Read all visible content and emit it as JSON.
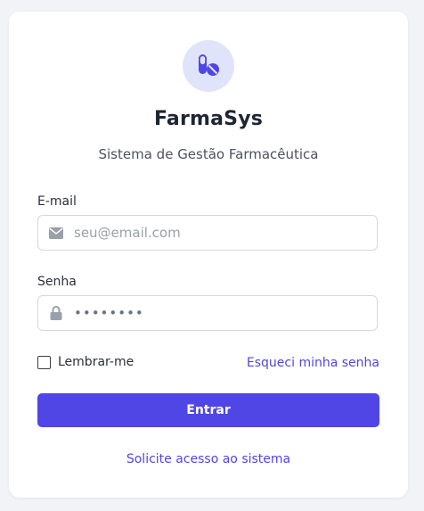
{
  "app": {
    "name": "FarmaSys",
    "tagline": "Sistema de Gestão Farmacêutica"
  },
  "form": {
    "email": {
      "label": "E-mail",
      "placeholder": "seu@email.com",
      "value": "",
      "icon": "envelope-icon"
    },
    "password": {
      "label": "Senha",
      "placeholder": "",
      "value": "••••••••",
      "icon": "lock-icon"
    },
    "remember_label": "Lembrar-me",
    "remember_checked": false,
    "forgot_label": "Esqueci minha senha",
    "submit_label": "Entrar"
  },
  "footer": {
    "request_access_label": "Solicite acesso ao sistema"
  },
  "colors": {
    "accent": "#4f46e5",
    "logo_bg": "#e0e4fb",
    "page_bg": "#f1f3f6"
  },
  "logo_icon": "pills-icon"
}
